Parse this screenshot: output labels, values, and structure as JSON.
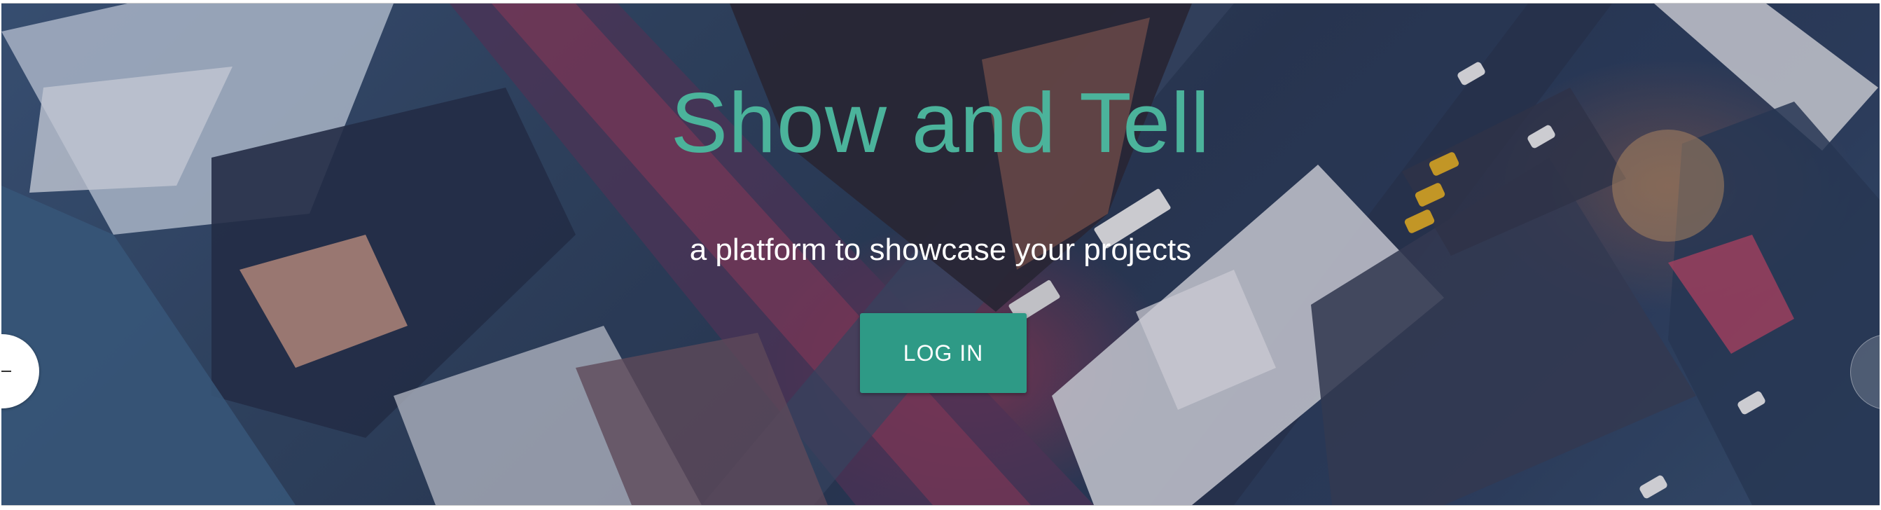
{
  "hero": {
    "title": "Show and Tell",
    "subtitle": "a platform to showcase your projects",
    "login_label": "LOG IN"
  },
  "carousel": {
    "prev_icon": "arrow-left-icon",
    "next_icon": "arrow-right-icon"
  },
  "colors": {
    "title": "#4bb39b",
    "button": "#2e9a86",
    "subtitle": "#ffffff"
  }
}
